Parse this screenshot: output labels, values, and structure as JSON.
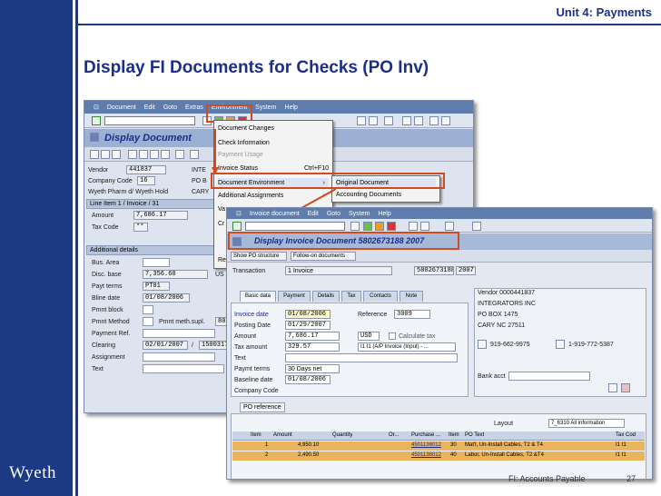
{
  "header": {
    "unit": "Unit 4: Payments",
    "title": "Display FI Documents for Checks (PO Inv)"
  },
  "logo": "Wyeth",
  "footer": {
    "label": "FI: Accounts Payable",
    "page": "27"
  },
  "win1": {
    "menu": [
      "Document",
      "Edit",
      "Goto",
      "Extras",
      "Environment",
      "System",
      "Help"
    ],
    "screen_title": "Display Document",
    "vendor_label": "Vendor",
    "vendor": "441837",
    "vendor_name": "INTE",
    "cc_label": "Company Code",
    "cc": "16",
    "pob_label": "PO B",
    "name_line": "Wyeth Pharm d/ Wyeth Hold",
    "city": "CARY",
    "line_item": "Line Item 1 / Invoice / 31",
    "amount_label": "Amount",
    "amount": "7,686.17",
    "tax_label": "Tax Code",
    "tax": "**",
    "add_details": "Additional details",
    "bus_area": "Bus. Area",
    "disc_base_label": "Disc. base",
    "disc_base": "7,356.60",
    "currency": "US",
    "payt_terms_label": "Payt terms",
    "payt_terms": "PT01",
    "bline_label": "Bline date",
    "bline": "01/08/2006",
    "pmnt_block": "Pmnt block",
    "pmnt_method": "Pmnt Method",
    "pmnt_supl": "Pmnt meth.supl.",
    "pmnt_supl_val": "80",
    "payment_ref": "Payment Ref.",
    "clearing_label": "Clearing",
    "clearing": "02/01/2007",
    "clearing_sep": "/",
    "clearing_doc": "1500317",
    "assignment": "Assignment",
    "text": "Text"
  },
  "envmenu": {
    "items": [
      {
        "label": "Document Changes",
        "disabled": false
      },
      {
        "label": "Check Information",
        "disabled": false
      },
      {
        "label": "Payment Usage",
        "disabled": true
      },
      {
        "label": "Invoice Status",
        "disabled": false,
        "shortcut": "Ctrl+F10"
      },
      {
        "label": "Document Environment",
        "disabled": false,
        "arrow": "›"
      },
      {
        "label": "Additional Assignments",
        "disabled": false,
        "arrow": "›"
      },
      {
        "label": "Va",
        "disabled": false
      },
      {
        "label": "Cr",
        "disabled": false
      },
      {
        "label": "Re",
        "disabled": false
      }
    ],
    "submenu": [
      "Original Document",
      "Accounting Documents"
    ]
  },
  "win2": {
    "menu": [
      "Invoice document",
      "Edit",
      "Goto",
      "System",
      "Help"
    ],
    "screen_title": "Display Invoice Document 5802673188 2007",
    "btn_po_structure": "Show PO structure",
    "btn_follow_on": "Follow-on documents",
    "transaction_label": "Transaction",
    "transaction": "1 Invoice",
    "doc_no": "5802673188",
    "year": "2007",
    "tabs": [
      "Basic data",
      "Payment",
      "Details",
      "Tax",
      "Contacts",
      "Note"
    ],
    "invoice_date_label": "Invoice date",
    "invoice_date": "01/08/2006",
    "reference_label": "Reference",
    "reference": "3009",
    "posting_date_label": "Posting Date",
    "posting_date": "01/29/2007",
    "amount_label": "Amount",
    "amount": "7,686.17",
    "amount_cur": "USD",
    "calc_tax": "Calculate tax",
    "tax_amount_label": "Tax amount",
    "tax_amount": "329.57",
    "tax_code": "I1 I1 (A/P Invoice (Input) - ...",
    "text_label": "Text",
    "payment_terms_label": "Paymt terms",
    "payment_terms": "30 Days net",
    "baseline_label": "Baseline date",
    "baseline": "01/08/2006",
    "company_code_label": "Company Code",
    "vendor_title": "Vendor 0000441837",
    "vendor_lines": [
      "INTEGRATORS INC",
      "PO BOX 1475",
      "CARY NC  27511"
    ],
    "phone1": "919-662-9975",
    "phone2": "1-919-772-5387",
    "bank_acct": "Bank acct",
    "po_reference": "PO reference",
    "layout_label": "Layout",
    "layout_value": "7_6310 All information",
    "grid_headers": [
      "Item",
      "Amount",
      "Quantity",
      "Or...",
      "Purchase ...",
      "Item",
      "PO Text",
      "Tax Cod"
    ],
    "rows": [
      {
        "item": "1",
        "amount": "4,950.10",
        "po": "4501136012",
        "poitem": "30",
        "text": "Mat'l, Un-Install Cables, T2 & T4",
        "tax": "I1  I1"
      },
      {
        "item": "2",
        "amount": "2,490.50",
        "po": "4501136012",
        "poitem": "40",
        "text": "Labor, Un-Install Cables, T2 &T4",
        "tax": "I1  I1"
      }
    ]
  }
}
